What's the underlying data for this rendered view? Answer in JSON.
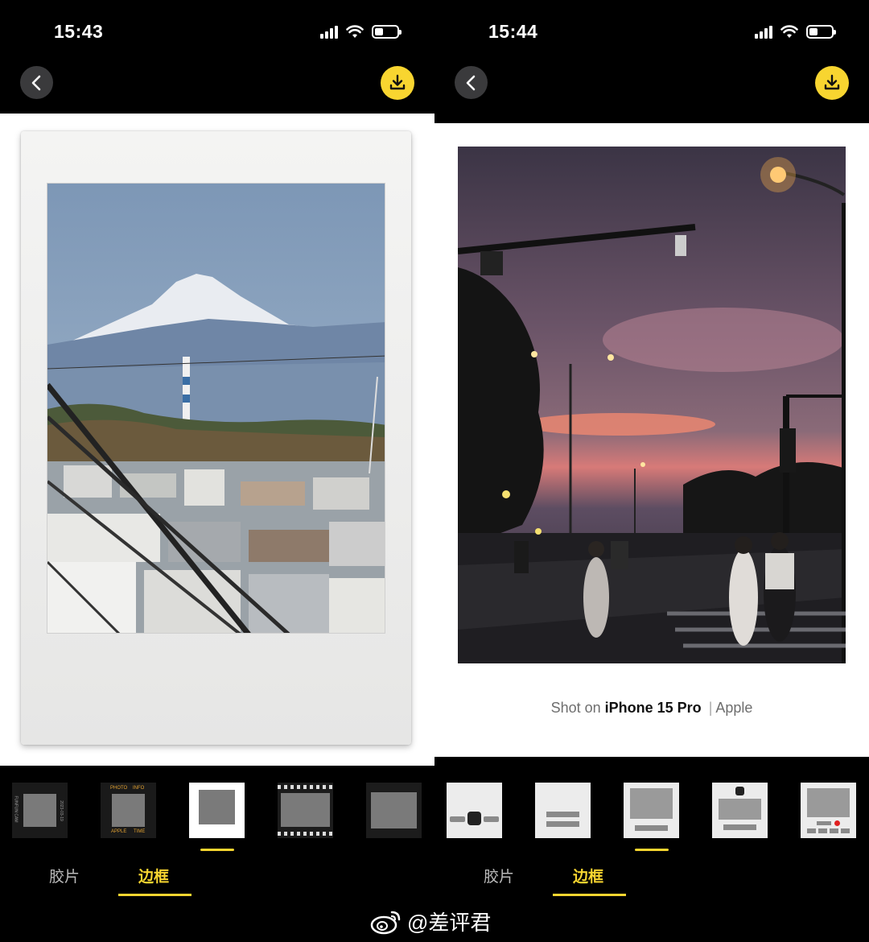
{
  "left_screen": {
    "status": {
      "time": "15:43",
      "battery_level": 0.35
    },
    "tabs": [
      {
        "label": "胶片",
        "active": false
      },
      {
        "label": "边框",
        "active": true
      }
    ],
    "thumbnails": [
      {
        "name": "film-vertical-text",
        "side_text": "FUNFUN CAM",
        "side_text_right": "2023-03-19"
      },
      {
        "name": "photo-info",
        "top_left": "PHOTO",
        "top_right": "INFO",
        "bottom_left": "APPLE",
        "bottom_right": "TIME"
      },
      {
        "name": "instax-white",
        "selected": true
      },
      {
        "name": "film-strip-1"
      },
      {
        "name": "film-strip-2"
      }
    ]
  },
  "right_screen": {
    "status": {
      "time": "15:44",
      "battery_level": 0.35
    },
    "caption": {
      "prefix": "Shot on",
      "device": "iPhone 15 Pro",
      "separator": "|",
      "brand": "Apple"
    },
    "tabs": [
      {
        "label": "胶片",
        "active": false
      },
      {
        "label": "边框",
        "active": true
      }
    ],
    "thumbnails": [
      {
        "name": "logo-center-bar"
      },
      {
        "name": "two-bars"
      },
      {
        "name": "photo-with-caption-bar",
        "selected": true
      },
      {
        "name": "logo-top-photo-bar"
      },
      {
        "name": "camera-controls"
      }
    ]
  },
  "watermark": {
    "text": "@差评君"
  },
  "colors": {
    "accent": "#f8d530",
    "back_button": "#3a3a3c"
  }
}
